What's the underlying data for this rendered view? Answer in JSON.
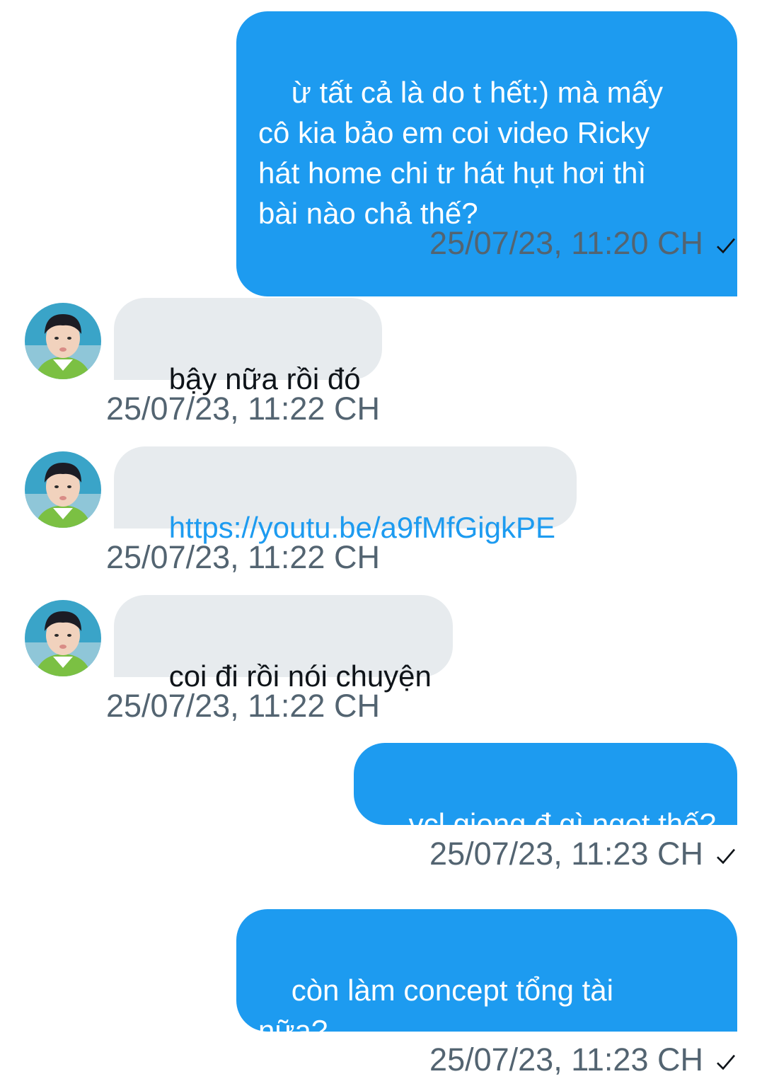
{
  "colors": {
    "outgoing_bubble": "#1d9bf0",
    "incoming_bubble": "#e7ebee",
    "link": "#1d9bf0",
    "timestamp": "#536471"
  },
  "messages": [
    {
      "direction": "out",
      "text": "ừ tất cả là do t hết:) mà mấy\ncô kia bảo em coi video Ricky\nhát home chi tr hát hụt hơi thì\nbài nào chả thế?",
      "time": "25/07/23, 11:20 CH",
      "status_icon": "check-icon"
    },
    {
      "direction": "in",
      "text": "bậy nữa rồi đó",
      "time": "25/07/23, 11:22 CH",
      "avatar": "avatar"
    },
    {
      "direction": "in",
      "text": "https://youtu.be/a9fMfGigkPE",
      "time": "25/07/23, 11:22 CH",
      "avatar": "avatar"
    },
    {
      "direction": "in",
      "text": "coi đi rồi nói chuyện",
      "time": "25/07/23, 11:22 CH",
      "avatar": "avatar"
    },
    {
      "direction": "out",
      "text": "vcl giọng đ gì ngọt thế?",
      "time": "25/07/23, 11:23 CH",
      "status_icon": "check-icon"
    },
    {
      "direction": "out",
      "text": "còn làm concept tổng tài\nnữa?",
      "time": "25/07/23, 11:23 CH",
      "status_icon": "check-icon"
    }
  ]
}
